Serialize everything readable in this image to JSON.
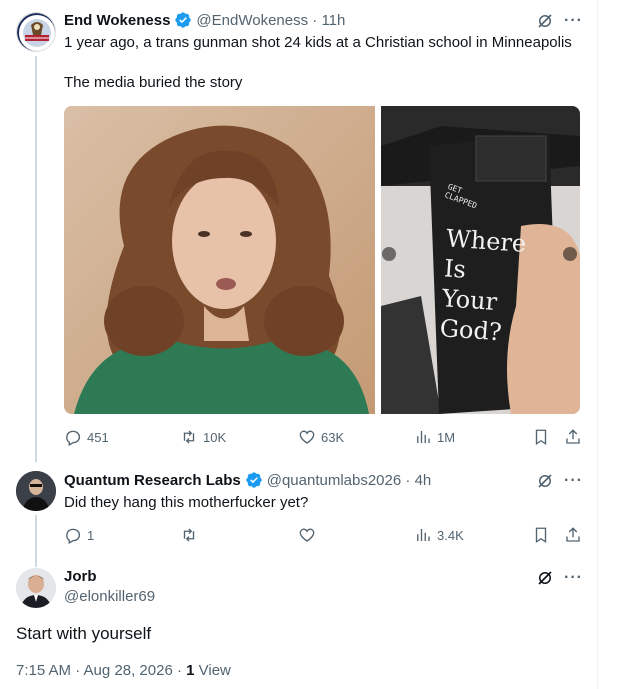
{
  "tweet1": {
    "name": "End Wokeness",
    "handle": "@EndWokeness",
    "time": "11h",
    "text_line1": "1 year ago, a trans gunman shot 24 kids at a Christian school in Minneapolis",
    "text_line2": "The media buried the story",
    "image2_text": "Where Is Your God?",
    "image2_small": "GET CLAPPED",
    "replies": "451",
    "reposts": "10K",
    "likes": "63K",
    "views": "1M"
  },
  "tweet2": {
    "name": "Quantum Research Labs",
    "handle": "@quantumlabs2026",
    "time": "4h",
    "text": "Did they hang this motherfucker yet?",
    "replies": "1",
    "reposts": "",
    "likes": "",
    "views": "3.4K"
  },
  "tweet3": {
    "name": "Jorb",
    "handle": "@elonkiller69",
    "text": "Start with yourself",
    "timestamp": "7:15 AM · Aug 28, 2026 · ",
    "views_count": "1",
    "views_label": " View"
  },
  "colors": {
    "verified": "#1d9bf0",
    "muted": "#536471",
    "text": "#0f1419",
    "thread_line": "#cfd9de"
  },
  "icons": [
    "verified-badge-icon",
    "grok-icon",
    "more-icon",
    "reply-icon",
    "repost-icon",
    "like-icon",
    "views-icon",
    "bookmark-icon",
    "share-icon"
  ]
}
